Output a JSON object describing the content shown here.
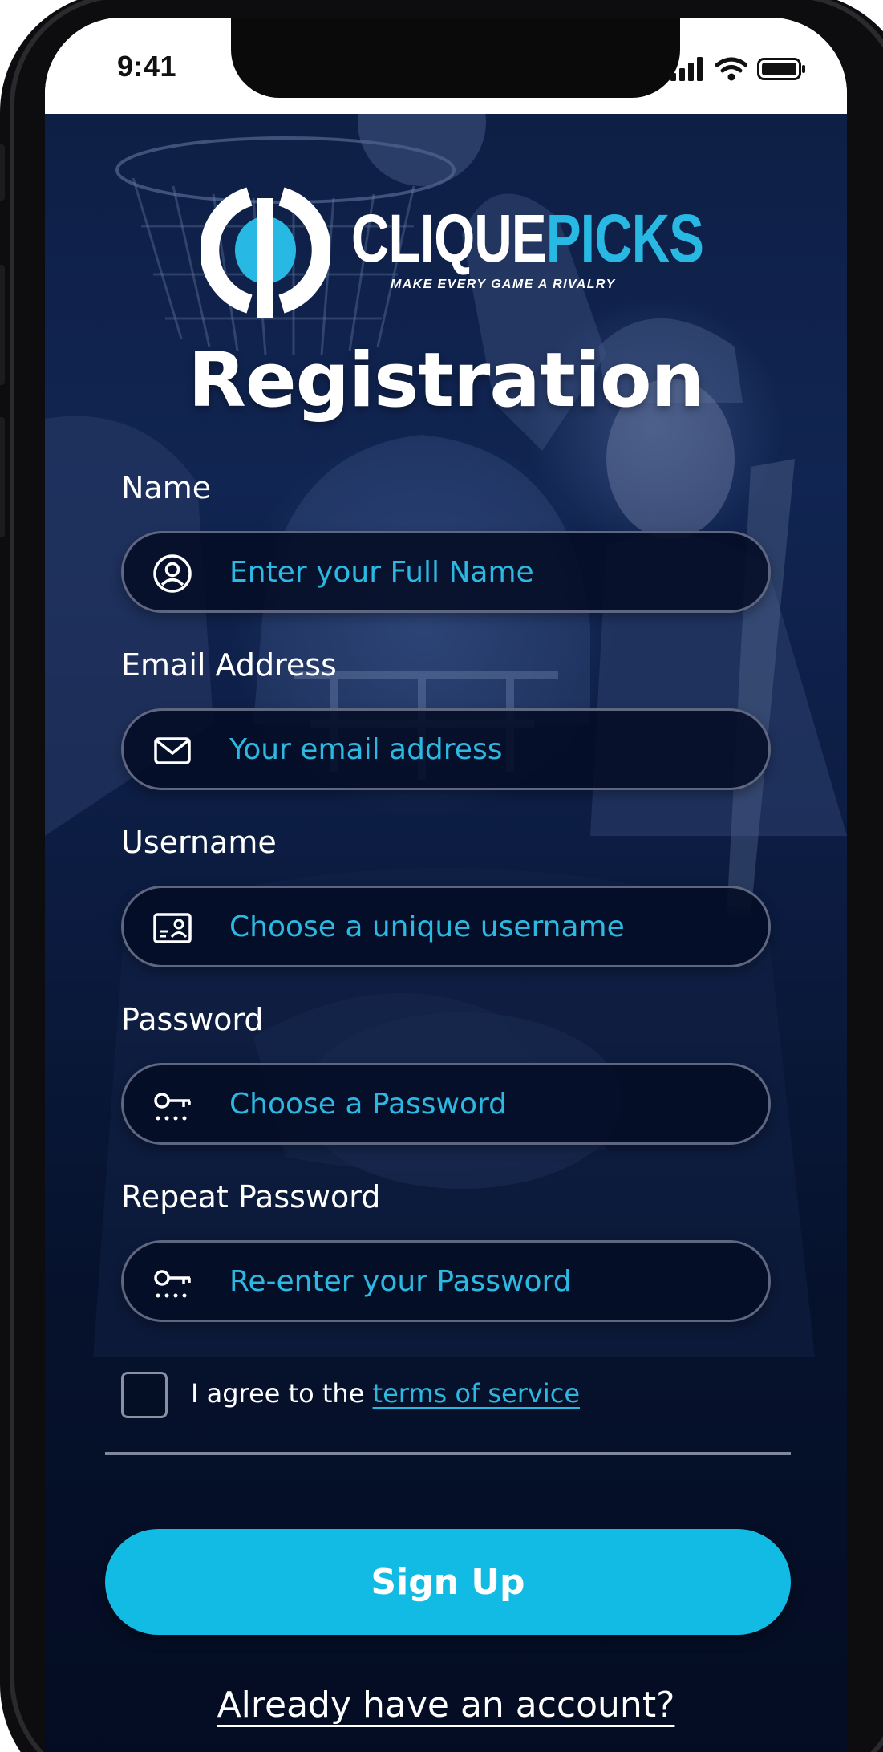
{
  "status_bar": {
    "time": "9:41",
    "icons": [
      "cellular-signal-icon",
      "wifi-icon",
      "battery-icon"
    ]
  },
  "brand": {
    "name_part1": "CLIQUE",
    "name_part2": "PICKS",
    "tagline": "MAKE EVERY GAME A RIVALRY",
    "colors": {
      "primary": "#ffffff",
      "accent": "#27b9e3"
    }
  },
  "page": {
    "title": "Registration"
  },
  "form": {
    "name": {
      "label": "Name",
      "placeholder": "Enter your Full Name",
      "value": "",
      "icon": "user-circle-icon"
    },
    "email": {
      "label": "Email Address",
      "placeholder": "Your email address",
      "value": "",
      "icon": "envelope-icon"
    },
    "username": {
      "label": "Username",
      "placeholder": "Choose a unique username",
      "value": "",
      "icon": "id-card-icon"
    },
    "password": {
      "label": "Password",
      "placeholder": "Choose a Password",
      "value": "",
      "icon": "key-password-icon"
    },
    "repeat_password": {
      "label": "Repeat Password",
      "placeholder": "Re-enter your Password",
      "value": "",
      "icon": "key-password-icon"
    },
    "agree": {
      "checked": false,
      "text": "I agree to the ",
      "link_text": "terms of service"
    }
  },
  "actions": {
    "signup_label": "Sign Up",
    "login_link": "Already have an account?"
  },
  "colors": {
    "background": "#0c1c41",
    "accent": "#12bbe4",
    "placeholder": "#2cb8e0",
    "field_border": "#5e6680"
  }
}
